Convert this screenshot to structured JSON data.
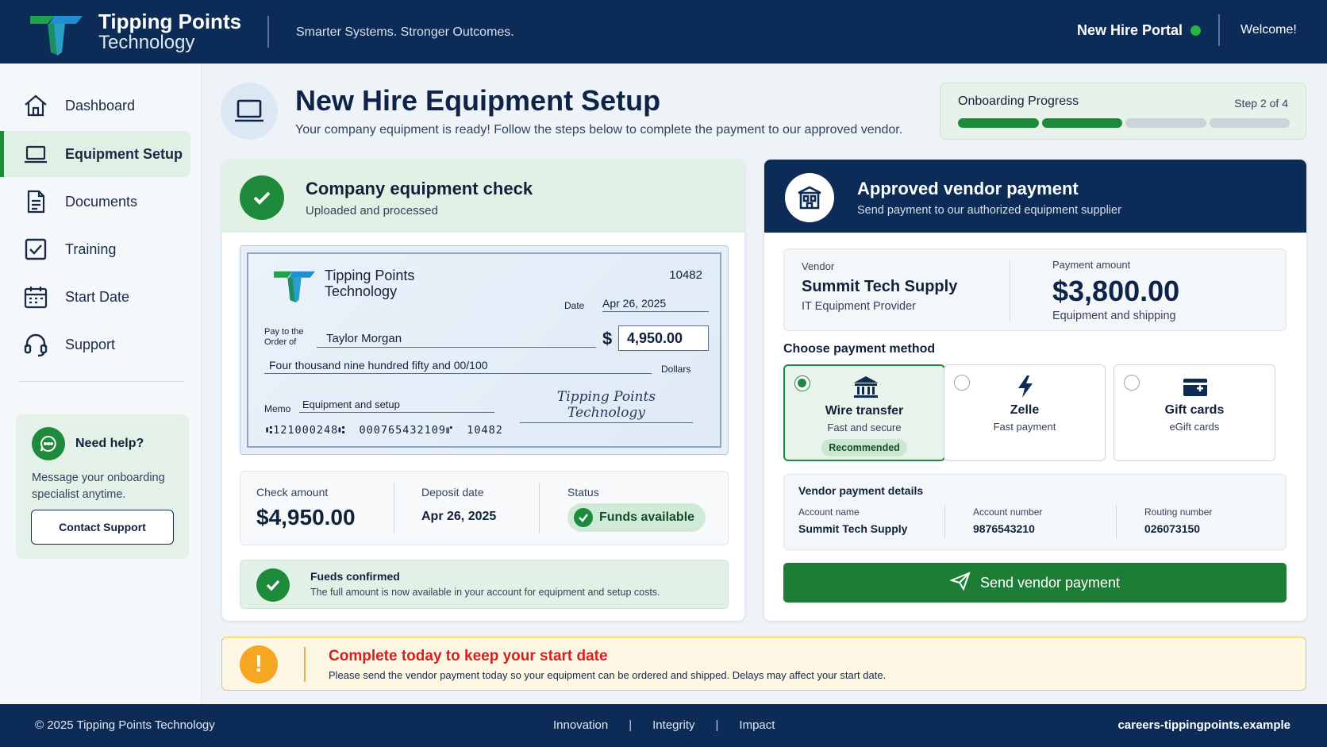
{
  "header": {
    "brand_line1": "Tipping Points",
    "brand_line2": "Technology",
    "tagline": "Smarter Systems. Stronger Outcomes.",
    "portal_label": "New Hire Portal",
    "welcome": "Welcome!"
  },
  "sidebar": {
    "items": [
      {
        "label": "Dashboard",
        "icon": "home-icon"
      },
      {
        "label": "Equipment Setup",
        "icon": "laptop-icon",
        "active": true
      },
      {
        "label": "Documents",
        "icon": "document-icon"
      },
      {
        "label": "Training",
        "icon": "checkbox-icon"
      },
      {
        "label": "Start Date",
        "icon": "calendar-icon"
      },
      {
        "label": "Support",
        "icon": "headset-icon"
      }
    ],
    "help": {
      "title": "Need help?",
      "text": "Message your onboarding specialist anytime.",
      "button": "Contact Support"
    }
  },
  "page": {
    "title": "New Hire Equipment Setup",
    "subtitle": "Your company equipment is ready! Follow the steps below to complete the payment to our approved vendor."
  },
  "progress": {
    "label": "Onboarding Progress",
    "step_text": "Step 2 of 4",
    "completed": 2,
    "total": 4
  },
  "equipment_check": {
    "title": "Company equipment check",
    "subtitle": "Uploaded and processed",
    "cheque": {
      "brand_line1": "Tipping Points",
      "brand_line2": "Technology",
      "number": "10482",
      "date_label": "Date",
      "date": "Apr 26, 2025",
      "pay_label_1": "Pay to the",
      "pay_label_2": "Order of",
      "payee": "Taylor Morgan",
      "currency": "$",
      "amount": "4,950.00",
      "amount_words": "Four thousand nine hundred fifty and 00/100",
      "dollars_label": "Dollars",
      "memo_label": "Memo",
      "memo": "Equipment and setup",
      "signature": "Tipping Points Technology",
      "micr": "⑆121000248⑆ 000765432109⑈ 10482"
    },
    "summary": {
      "check_amount_label": "Check amount",
      "check_amount": "$4,950.00",
      "deposit_date_label": "Deposit date",
      "deposit_date": "Apr 26, 2025",
      "status_label": "Status",
      "status": "Funds available"
    },
    "confirm": {
      "title": "Fueds confirmed",
      "text": "The full amount is now available in your account for equipment and setup costs."
    }
  },
  "vendor_payment": {
    "title": "Approved vendor payment",
    "subtitle": "Send payment to our authorized equipment supplier",
    "vendor_label": "Vendor",
    "vendor_name": "Summit Tech Supply",
    "vendor_desc": "IT Equipment Provider",
    "amount_label": "Payment amount",
    "amount": "$3,800.00",
    "amount_desc": "Equipment and shipping",
    "method_label": "Choose payment method",
    "methods": [
      {
        "name": "Wire transfer",
        "desc": "Fast and secure",
        "badge": "Recommended",
        "icon": "bank-icon",
        "selected": true
      },
      {
        "name": "Zelle",
        "desc": "Fast payment",
        "icon": "lightning-icon",
        "selected": false
      },
      {
        "name": "Gift cards",
        "desc": "eGift cards",
        "icon": "gift-card-icon",
        "selected": false
      }
    ],
    "details": {
      "title": "Vendor payment details",
      "account_name_label": "Account name",
      "account_name": "Summit Tech Supply",
      "account_number_label": "Account number",
      "account_number": "9876543210",
      "routing_number_label": "Routing number",
      "routing_number": "026073150"
    },
    "send_button": "Send vendor payment"
  },
  "warning": {
    "title": "Complete today to keep your start date",
    "text": "Please send the vendor payment today so your equipment can be ordered and shipped. Delays may affect your start date."
  },
  "footer": {
    "copyright": "© 2025 Tipping Points Technology",
    "links": [
      "Innovation",
      "Integrity",
      "Impact"
    ],
    "url": "careers-tippingpoints.example"
  },
  "colors": {
    "navy": "#0d2b57",
    "green": "#1e8a3c",
    "warning_red": "#d42020",
    "warning_amber": "#f5a623"
  }
}
